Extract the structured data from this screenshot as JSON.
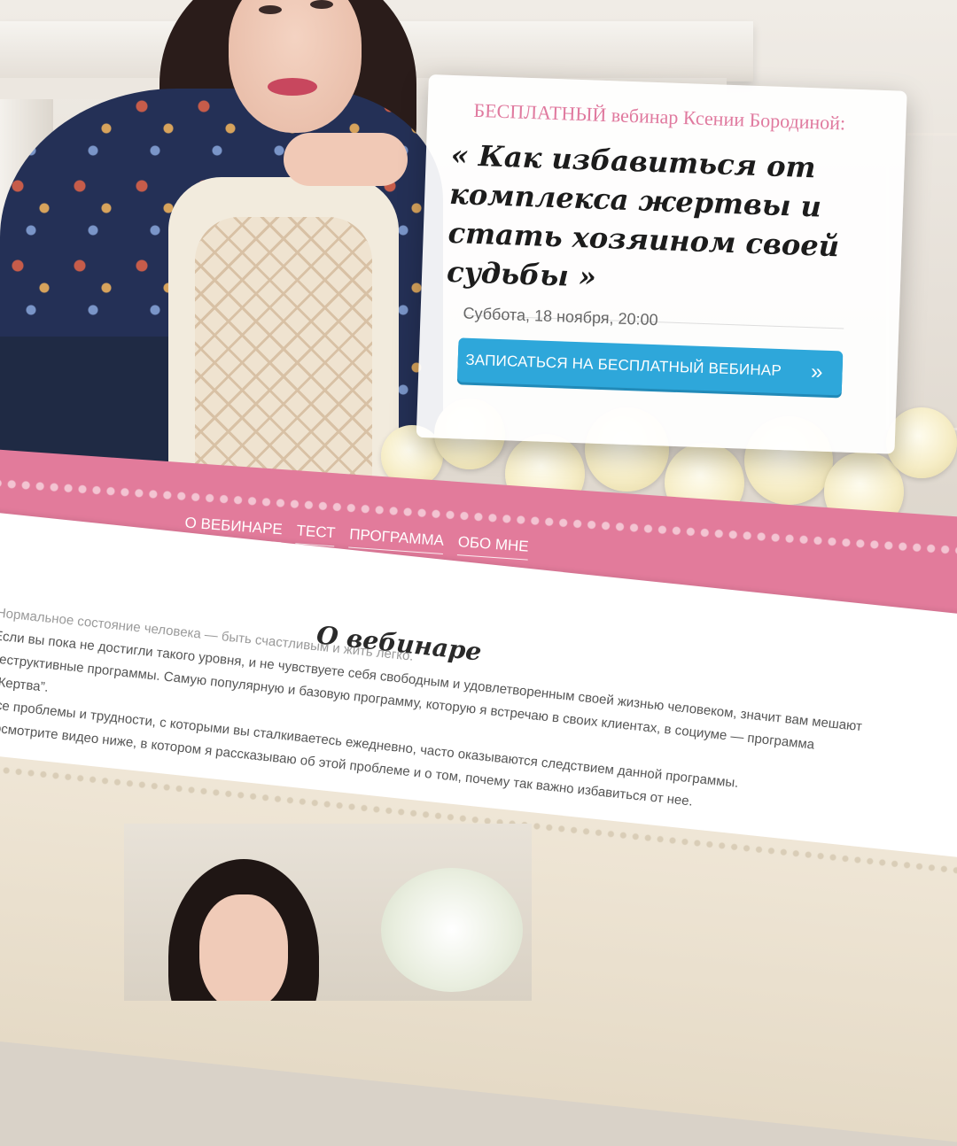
{
  "hero": {
    "kicker": "БЕСПЛАТНЫЙ вебинар Ксении Бородиной:",
    "title": "« Как избавиться от комплекса жертвы и стать хозяином своей судьбы »",
    "date": "Суббота, 18 ноября, 20:00",
    "cta_label": "ЗАПИСАТЬСЯ НА БЕСПЛАТНЫЙ ВЕБИНАР",
    "cta_icon": "»"
  },
  "nav": {
    "items": [
      {
        "label": "О ВЕБИНАРЕ"
      },
      {
        "label": "ТЕСТ"
      },
      {
        "label": "ПРОГРАММА"
      },
      {
        "label": "ОБО МНЕ"
      }
    ]
  },
  "about": {
    "title": "О вебинаре",
    "paragraphs": [
      "Нормальное состояние человека — быть счастливым и жить легко.",
      "Если вы пока не достигли такого уровня, и не чувствуете себя свободным и удовлетворенным своей жизнью человеком, значит вам мешают деструктивные программы. Самую популярную и базовую программу, которую я встречаю в своих клиентах, в социуме — программа “Жертва”.",
      "Все проблемы и трудности, с которыми вы сталкиваетесь ежедневно, часто оказываются следствием данной программы.",
      "Посмотрите видео ниже, в котором я рассказываю об этой проблеме и о том, почему так важно избавиться от нее."
    ]
  },
  "colors": {
    "accent_pink": "#e27b9b",
    "cta_blue": "#2ea7da",
    "kicker_pink": "#e07a9f"
  }
}
